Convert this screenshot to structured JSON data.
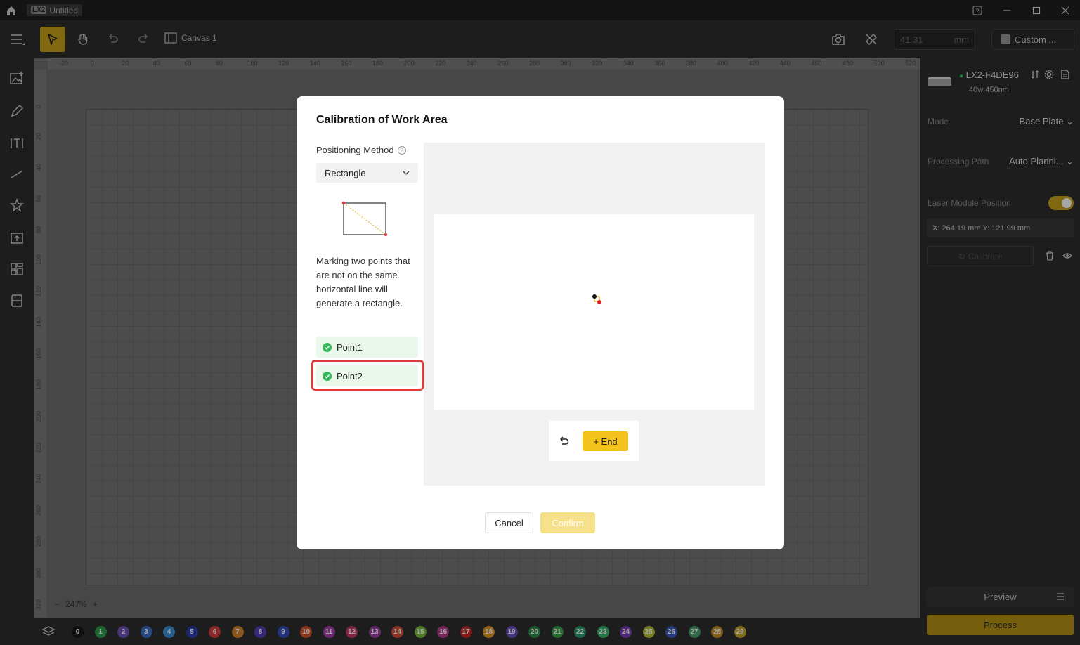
{
  "titlebar": {
    "app_badge": "LX2",
    "doc_name": "Untitled"
  },
  "toolbar": {
    "canvas_tab": "Canvas 1",
    "size_value": "41.31",
    "size_unit": "mm",
    "custom_label": "Custom ..."
  },
  "ruler": {
    "top_ticks": [
      "-20",
      "0",
      "20",
      "40",
      "60",
      "80",
      "100",
      "120",
      "140",
      "160",
      "180",
      "200",
      "220",
      "240",
      "260",
      "280",
      "300",
      "320",
      "340",
      "360",
      "380",
      "400",
      "420",
      "440",
      "460",
      "480",
      "500",
      "520"
    ],
    "left_ticks": [
      "0",
      "20",
      "40",
      "60",
      "80",
      "100",
      "120",
      "140",
      "160",
      "180",
      "200",
      "220",
      "240",
      "260",
      "280",
      "300",
      "320"
    ]
  },
  "zoom": {
    "minus": "−",
    "value": "247%",
    "plus": "+"
  },
  "layers": [
    {
      "n": "0",
      "color": "#1a1a1a"
    },
    {
      "n": "1",
      "color": "#2e9e4a"
    },
    {
      "n": "2",
      "color": "#6f4fb8"
    },
    {
      "n": "3",
      "color": "#3c6fc4"
    },
    {
      "n": "4",
      "color": "#3a8fd6"
    },
    {
      "n": "5",
      "color": "#2a3fb0"
    },
    {
      "n": "6",
      "color": "#d83c3c"
    },
    {
      "n": "7",
      "color": "#d6842a"
    },
    {
      "n": "8",
      "color": "#5a3fb8"
    },
    {
      "n": "9",
      "color": "#3550c0"
    },
    {
      "n": "10",
      "color": "#d6552a"
    },
    {
      "n": "11",
      "color": "#a83fb0"
    },
    {
      "n": "12",
      "color": "#c23c6a"
    },
    {
      "n": "13",
      "color": "#9a3fa0"
    },
    {
      "n": "14",
      "color": "#d6503a"
    },
    {
      "n": "15",
      "color": "#7ab83c"
    },
    {
      "n": "16",
      "color": "#b83c8a"
    },
    {
      "n": "17",
      "color": "#c42a2a"
    },
    {
      "n": "18",
      "color": "#e09a2a"
    },
    {
      "n": "19",
      "color": "#6a4fc0"
    },
    {
      "n": "20",
      "color": "#2e8a4a"
    },
    {
      "n": "21",
      "color": "#3aa04a"
    },
    {
      "n": "22",
      "color": "#2a9a6a"
    },
    {
      "n": "23",
      "color": "#3ab86a"
    },
    {
      "n": "24",
      "color": "#7a3fb8"
    },
    {
      "n": "25",
      "color": "#b8c23c"
    },
    {
      "n": "26",
      "color": "#3a5ac4"
    },
    {
      "n": "27",
      "color": "#4aa06a"
    },
    {
      "n": "28",
      "color": "#c4902a"
    },
    {
      "n": "29",
      "color": "#c4a82a"
    }
  ],
  "right_panel": {
    "device_name": "LX2-F4DE96",
    "device_spec": "40w 450nm",
    "mode_label": "Mode",
    "mode_value": "Base Plate",
    "path_label": "Processing Path",
    "path_value": "Auto Planni...",
    "laser_label": "Laser Module Position",
    "coords": "X: 264.19 mm  Y: 121.99 mm",
    "calibrate_label": "Calibrate",
    "preview_label": "Preview",
    "process_label": "Process"
  },
  "dialog": {
    "title": "Calibration of Work Area",
    "method_label": "Positioning Method",
    "help": "?",
    "method_value": "Rectangle",
    "description": "Marking two points that are not on the same horizontal line will generate a rectangle.",
    "points": [
      "Point1",
      "Point2"
    ],
    "end_label": "+ End",
    "cancel_label": "Cancel",
    "confirm_label": "Confirm"
  },
  "colors": {
    "accent": "#f4c21c",
    "success": "#34b85b",
    "highlight": "#e03a3a",
    "dark_bg": "#2d2d2d"
  }
}
